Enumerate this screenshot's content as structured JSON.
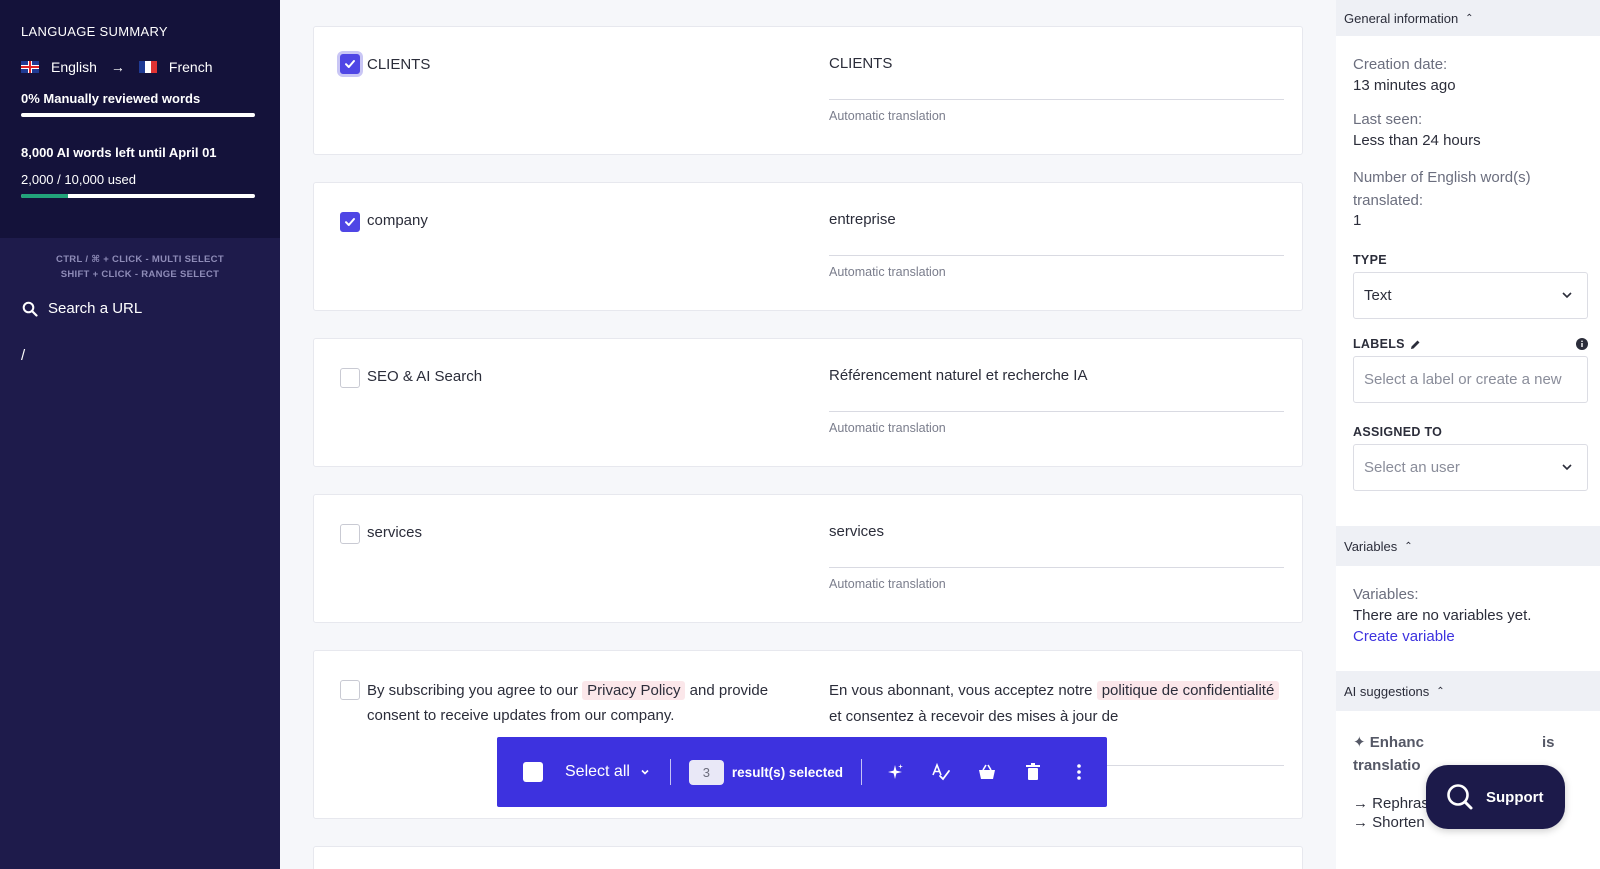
{
  "sidebar": {
    "summary_title": "LANGUAGE SUMMARY",
    "source_language": "English",
    "target_language": "French",
    "reviewed_text": "0% Manually reviewed words",
    "reviewed_progress": 0,
    "ai_words_left": "8,000 AI words left until April 01",
    "ai_used_text": "2,000 / 10,000 used",
    "ai_used_progress": 0.2,
    "shortcut_multi": "CTRL / ⌘ + CLICK - MULTI SELECT",
    "shortcut_range": "SHIFT + CLICK - RANGE SELECT",
    "search_url_label": "Search a URL",
    "path": "/"
  },
  "segments": [
    {
      "source": "CLIENTS",
      "target": "CLIENTS",
      "status": "Automatic translation",
      "checked": true
    },
    {
      "source": "company",
      "target": "entreprise",
      "status": "Automatic translation",
      "checked": true
    },
    {
      "source": "SEO & AI Search",
      "target": "Référencement naturel et recherche IA",
      "status": "Automatic translation",
      "checked": false
    },
    {
      "source": "services",
      "target": "services",
      "status": "Automatic translation",
      "checked": false
    },
    {
      "source_part1": "By subscribing you agree to our",
      "source_highlight": "Privacy Policy",
      "source_part2": "and provide consent to receive updates from our company.",
      "target_part1": "En vous abonnant, vous acceptez notre",
      "target_highlight": "politique de confidentialité",
      "target_part2": "et consentez à recevoir des mises à jour de",
      "checked": false
    }
  ],
  "action_bar": {
    "select_all_label": "Select all",
    "selected_count": "3",
    "selected_label": "result(s) selected"
  },
  "right_panel": {
    "general_info_title": "General information",
    "creation_date_label": "Creation date:",
    "creation_date_value": "13 minutes ago",
    "last_seen_label": "Last seen:",
    "last_seen_value": "Less than 24 hours",
    "word_count_label": "Number of English word(s) translated:",
    "word_count_value": "1",
    "type_title": "TYPE",
    "type_value": "Text",
    "labels_title": "LABELS",
    "labels_placeholder": "Select a label or create a new",
    "assigned_title": "ASSIGNED TO",
    "assigned_placeholder": "Select an user",
    "variables_title": "Variables",
    "variables_label": "Variables:",
    "variables_empty": "There are no variables yet.",
    "create_variable_link": "Create variable",
    "ai_suggestions_title": "AI suggestions",
    "enhance_label_part1": "Enhanc",
    "enhance_label_tail": "is",
    "enhance_label_line2": "translatio",
    "rephrase": "Rephrase",
    "shorten": "Shorten"
  },
  "support_label": "Support",
  "colors": {
    "accent": "#3d32df",
    "sidebar_bg": "#1e1b4b",
    "progress_green": "#22a37a"
  }
}
